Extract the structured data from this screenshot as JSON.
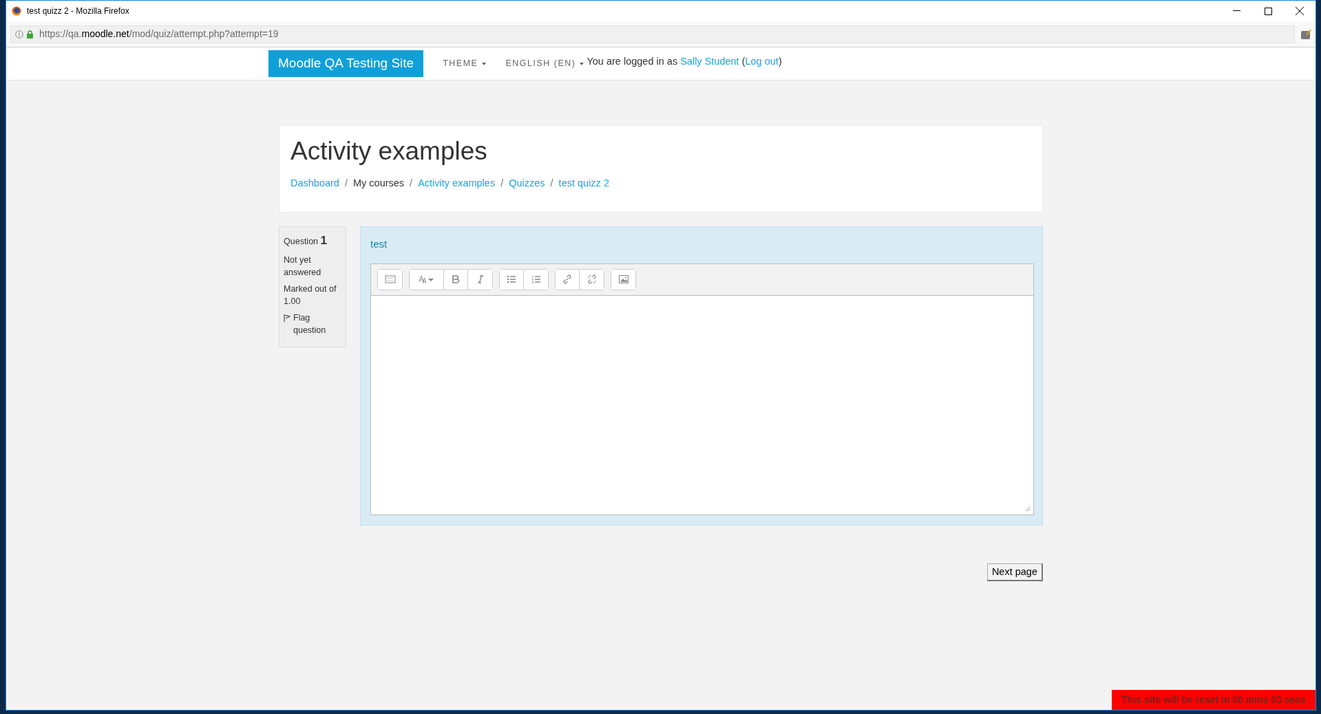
{
  "window": {
    "title": "test quizz 2 - Mozilla Firefox"
  },
  "address_bar": {
    "url_scheme": "https://qa.",
    "url_host": "moodle.net",
    "url_path": "/mod/quiz/attempt.php?attempt=19"
  },
  "navbar": {
    "brand": "Moodle QA Testing Site",
    "menus": [
      {
        "label": "THEME",
        "kind": "dropdown"
      },
      {
        "label": "ENGLISH (EN)",
        "kind": "dropdown"
      }
    ],
    "login": {
      "prefix": "You are logged in as",
      "user": "Sally Student",
      "paren_open": "(",
      "logout": "Log out",
      "paren_close": ")"
    }
  },
  "page_header": {
    "title": "Activity examples",
    "breadcrumbs": [
      {
        "label": "Dashboard",
        "kind": "link"
      },
      {
        "label": "My courses",
        "kind": "text"
      },
      {
        "label": "Activity examples",
        "kind": "link"
      },
      {
        "label": "Quizzes",
        "kind": "link"
      },
      {
        "label": "test quizz 2",
        "kind": "link"
      }
    ],
    "separator": "/"
  },
  "question_info": {
    "label": "Question",
    "number": "1",
    "state": "Not yet answered",
    "marks": "Marked out of 1.00",
    "flag": "Flag question"
  },
  "question": {
    "text": "test"
  },
  "next_button": "Next page",
  "reset_banner": "This site will be reset in 00 mins 03 secs"
}
